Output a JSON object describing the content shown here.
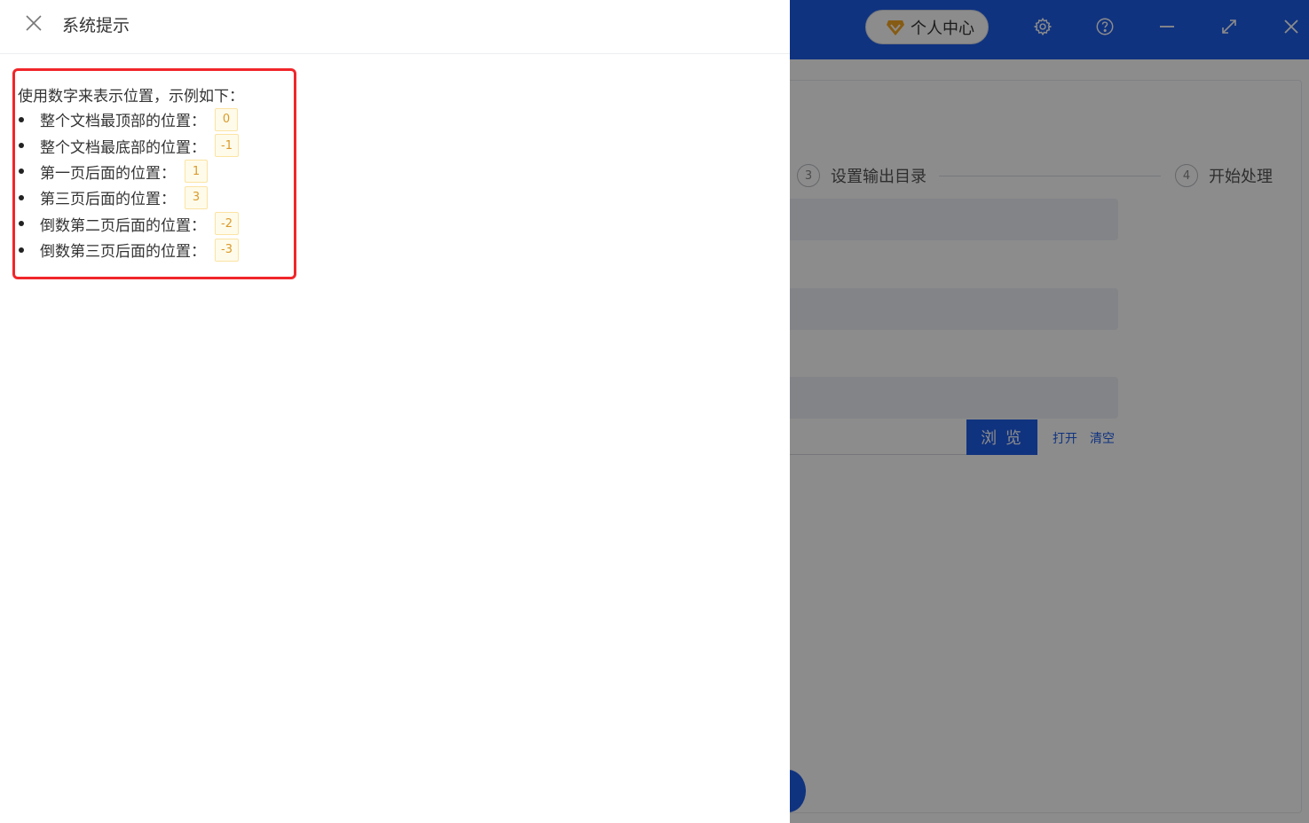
{
  "drawer": {
    "title": "系统提示",
    "intro": "使用数字来表示位置，示例如下：",
    "items": [
      {
        "label": "整个文档最顶部的位置：",
        "value": "0"
      },
      {
        "label": "整个文档最底部的位置：",
        "value": "-1"
      },
      {
        "label": "第一页后面的位置：",
        "value": "1"
      },
      {
        "label": "第三页后面的位置：",
        "value": "3"
      },
      {
        "label": "倒数第二页后面的位置：",
        "value": "-2"
      },
      {
        "label": "倒数第三页后面的位置：",
        "value": "-3"
      }
    ]
  },
  "app": {
    "vip_label": "个人中心",
    "steps": [
      {
        "num": "3",
        "label": "设置输出目录"
      },
      {
        "num": "4",
        "label": "开始处理"
      }
    ],
    "browse_label": "浏 览",
    "open_label": "打开",
    "clear_label": "清空"
  },
  "colors": {
    "primary": "#1e5ee8",
    "highlight_border": "#f0262a",
    "code_text": "#d99a2b",
    "code_bg": "#fffbea"
  }
}
